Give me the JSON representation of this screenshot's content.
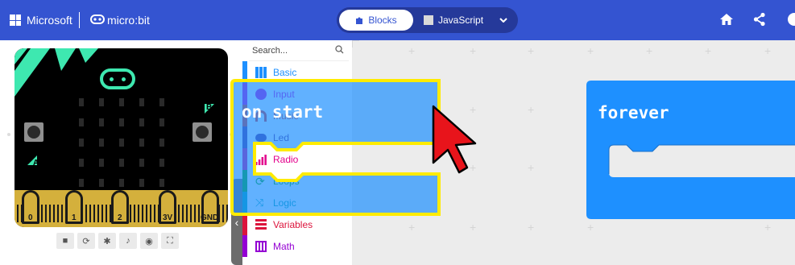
{
  "header": {
    "brand": "Microsoft",
    "product": "micro:bit",
    "tabs": {
      "blocks": "Blocks",
      "javascript": "JavaScript"
    }
  },
  "simulator": {
    "pins": [
      "0",
      "1",
      "2",
      "3V",
      "GND"
    ],
    "button_a": "A",
    "button_b": "B"
  },
  "toolbox": {
    "search_placeholder": "Search...",
    "categories": [
      {
        "label": "Basic",
        "color": "#1e90ff"
      },
      {
        "label": "Input",
        "color": "#d400d4"
      },
      {
        "label": "Music",
        "color": "#e63022"
      },
      {
        "label": "Led",
        "color": "#5c2d91"
      },
      {
        "label": "Radio",
        "color": "#e3008c"
      },
      {
        "label": "Loops",
        "color": "#00aa00"
      },
      {
        "label": "Logic",
        "color": "#00a4a6"
      },
      {
        "label": "Variables",
        "color": "#dc143c"
      },
      {
        "label": "Math",
        "color": "#9400d3"
      }
    ]
  },
  "workspace": {
    "forever_block": "forever",
    "dragging_block": "on start"
  },
  "colors": {
    "header": "#3454d1",
    "block_basic": "#1e90ff",
    "highlight": "#ffeb00",
    "pointer": "#e8141b"
  }
}
